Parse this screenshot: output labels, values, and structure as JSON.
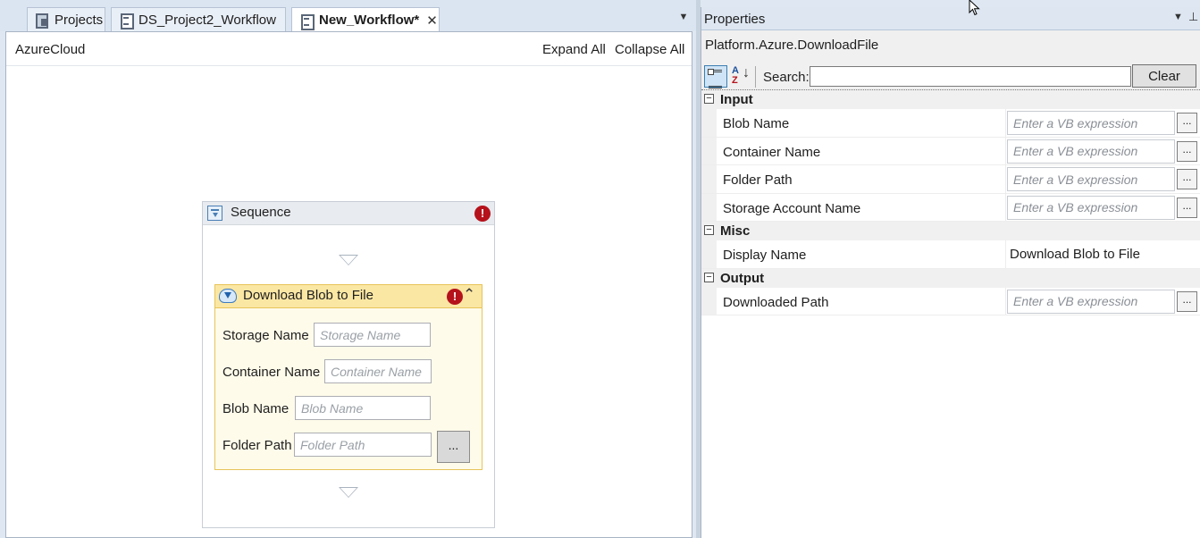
{
  "tabs": [
    {
      "label": "Projects",
      "icon": "projects-icon"
    },
    {
      "label": "DS_Project2_Workflow",
      "icon": "document-icon"
    },
    {
      "label": "New_Workflow*",
      "icon": "document-icon",
      "active": true,
      "close": "✕"
    }
  ],
  "designer": {
    "breadcrumb": "AzureCloud",
    "expand_all": "Expand All",
    "collapse_all": "Collapse All",
    "sequence": {
      "title": "Sequence",
      "error_mark": "!"
    },
    "activity": {
      "title": "Download Blob to File",
      "error_mark": "!",
      "collapse_glyph": "⌃",
      "fields": [
        {
          "label": "Storage Name",
          "placeholder": "Storage Name"
        },
        {
          "label": "Container Name",
          "placeholder": "Container Name"
        },
        {
          "label": "Blob Name",
          "placeholder": "Blob Name"
        },
        {
          "label": "Folder Path",
          "placeholder": "Folder Path"
        }
      ],
      "browse_label": "..."
    }
  },
  "properties": {
    "title": "Properties",
    "type_name": "Platform.Azure.DownloadFile",
    "search_label": "Search:",
    "search_value": "",
    "clear_label": "Clear",
    "categories": [
      {
        "name": "Input",
        "toggle": "−",
        "rows": [
          {
            "name": "Blob Name",
            "placeholder": "Enter a VB expression",
            "button": "..."
          },
          {
            "name": "Container Name",
            "placeholder": "Enter a VB expression",
            "button": "..."
          },
          {
            "name": "Folder Path",
            "placeholder": "Enter a VB expression",
            "button": "..."
          },
          {
            "name": "Storage Account Name",
            "placeholder": "Enter a VB expression",
            "button": "..."
          }
        ]
      },
      {
        "name": "Misc",
        "toggle": "−",
        "rows": [
          {
            "name": "Display Name",
            "value": "Download Blob to File"
          }
        ]
      },
      {
        "name": "Output",
        "toggle": "−",
        "rows": [
          {
            "name": "Downloaded Path",
            "placeholder": "Enter a VB expression",
            "button": "..."
          }
        ]
      }
    ]
  },
  "colors": {
    "error": "#b5121b",
    "activity_header": "#fbe7a4",
    "activity_border": "#e7c45a",
    "pane_background": "#dfe7f2"
  }
}
